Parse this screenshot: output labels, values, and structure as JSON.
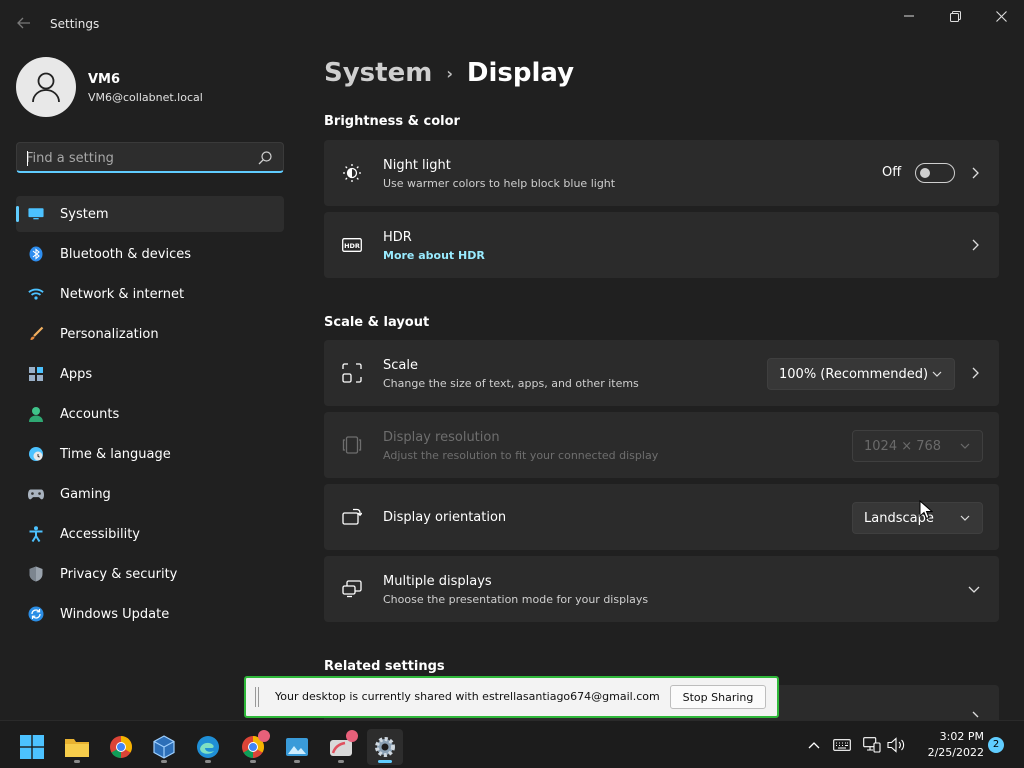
{
  "window": {
    "title": "Settings",
    "controls": [
      "minimize",
      "maximize",
      "close"
    ]
  },
  "profile": {
    "name": "VM6",
    "email": "VM6@collabnet.local"
  },
  "search": {
    "placeholder": "Find a setting"
  },
  "sidebar": {
    "items": [
      {
        "label": "System",
        "icon": "monitor-icon",
        "active": true
      },
      {
        "label": "Bluetooth & devices",
        "icon": "bluetooth-icon"
      },
      {
        "label": "Network & internet",
        "icon": "wifi-icon"
      },
      {
        "label": "Personalization",
        "icon": "brush-icon"
      },
      {
        "label": "Apps",
        "icon": "apps-icon"
      },
      {
        "label": "Accounts",
        "icon": "person-icon"
      },
      {
        "label": "Time & language",
        "icon": "clock-globe-icon"
      },
      {
        "label": "Gaming",
        "icon": "gamepad-icon"
      },
      {
        "label": "Accessibility",
        "icon": "accessibility-icon"
      },
      {
        "label": "Privacy & security",
        "icon": "shield-icon"
      },
      {
        "label": "Windows Update",
        "icon": "update-icon"
      }
    ]
  },
  "breadcrumb": {
    "parent": "System",
    "separator": "›",
    "current": "Display"
  },
  "sections": {
    "brightness": "Brightness & color",
    "scale_layout": "Scale & layout",
    "related": "Related settings"
  },
  "cards": {
    "night_light": {
      "title": "Night light",
      "subtitle": "Use warmer colors to help block blue light",
      "state": "Off",
      "icon": "night-light-icon"
    },
    "hdr": {
      "title": "HDR",
      "link": "More about HDR",
      "icon": "hdr-icon"
    },
    "scale": {
      "title": "Scale",
      "subtitle": "Change the size of text, apps, and other items",
      "value": "100% (Recommended)",
      "icon": "scale-icon"
    },
    "resolution": {
      "title": "Display resolution",
      "subtitle": "Adjust the resolution to fit your connected display",
      "value": "1024 × 768",
      "disabled": true,
      "icon": "resolution-icon"
    },
    "orientation": {
      "title": "Display orientation",
      "value": "Landscape",
      "icon": "orientation-icon"
    },
    "multiple": {
      "title": "Multiple displays",
      "subtitle": "Choose the presentation mode for your displays",
      "icon": "multiple-displays-icon"
    }
  },
  "sharing_banner": {
    "text": "Your desktop is currently shared with estrellasantiago674@gmail.com",
    "button": "Stop Sharing"
  },
  "taskbar": {
    "apps": [
      "start",
      "file-explorer",
      "chrome",
      "virtualbox",
      "edge",
      "chrome-profile",
      "app-3d",
      "app-badge",
      "settings"
    ],
    "time": "3:02 PM",
    "date": "2/25/2022",
    "notification_count": "2"
  },
  "colors": {
    "accent": "#60cdff",
    "background": "#202020",
    "card": "#2b2b2b",
    "share_border": "#2fb83a"
  }
}
